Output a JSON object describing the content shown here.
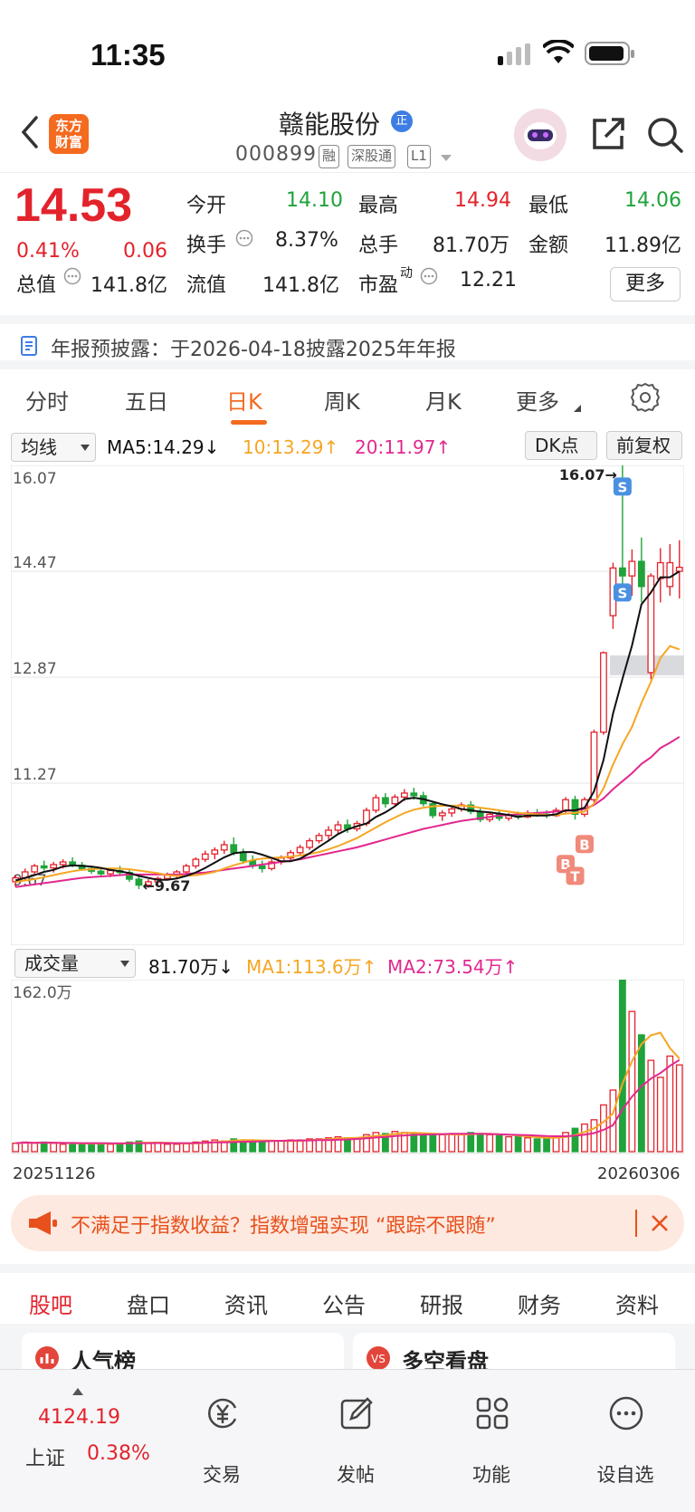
{
  "status_bar": {
    "time": "11:35"
  },
  "header": {
    "logo_line1": "东方",
    "logo_line2": "财富",
    "stock_name": "赣能股份",
    "verified_badge": "正",
    "stock_code": "000899",
    "tags": [
      "融",
      "深股通",
      "L1"
    ]
  },
  "quote": {
    "price": "14.53",
    "change_pct": "0.41%",
    "change": "0.06",
    "fields": [
      {
        "label": "今开",
        "value": "14.10",
        "color": "green"
      },
      {
        "label": "最高",
        "value": "14.94",
        "color": "red"
      },
      {
        "label": "最低",
        "value": "14.06",
        "color": "green"
      },
      {
        "label": "换手",
        "value": "8.37%",
        "color": "black"
      },
      {
        "label": "总手",
        "value": "81.70万",
        "color": "black"
      },
      {
        "label": "金额",
        "value": "11.89亿",
        "color": "black"
      },
      {
        "label": "总值",
        "value": "141.8亿",
        "color": "black"
      },
      {
        "label": "流值",
        "value": "141.8亿",
        "color": "black"
      },
      {
        "label": "市盈",
        "value": "12.21",
        "color": "black"
      }
    ],
    "pe_sup": "动",
    "more_label": "更多"
  },
  "notice": {
    "text": "年报预披露：于2026-04-18披露2025年年报"
  },
  "kline_tabs": {
    "items": [
      "分时",
      "五日",
      "日K",
      "周K",
      "月K",
      "更多"
    ],
    "active": 2
  },
  "ma_legend": {
    "indicator": "均线",
    "ma5": "MA5:14.29↓",
    "ma10": "10:13.29↑",
    "ma20": "20:11.97↑",
    "dk_label": "DK点",
    "adjust_label": "前复权"
  },
  "vol_legend": {
    "indicator": "成交量",
    "vol": "81.70万↓",
    "ma1": "MA1:113.6万↑",
    "ma2": "MA2:73.54万↑"
  },
  "colors": {
    "up": "#e3232c",
    "down": "#20a33b",
    "ma5": "#111111",
    "ma10": "#f5a623",
    "ma20": "#e2288f",
    "accent": "#f46a1f",
    "signal_b": "#f08a7a",
    "signal_s": "#4a90e2"
  },
  "chart_data": {
    "type": "candlestick",
    "y_ticks": [
      "16.07",
      "14.47",
      "12.87",
      "11.27",
      "9.67"
    ],
    "ylim": [
      9.67,
      16.07
    ],
    "max_label": "16.07→",
    "min_label": "←9.67",
    "signals": [
      "S",
      "S",
      "B",
      "B",
      "T"
    ],
    "volume": {
      "max_label": "162.0万",
      "ymax": 162.0,
      "start_date": "20251126",
      "end_date": "20260306"
    },
    "candles": [
      [
        9.78,
        9.88,
        9.7,
        9.84
      ],
      [
        9.84,
        9.98,
        9.8,
        9.93
      ],
      [
        9.93,
        10.05,
        9.88,
        10.02
      ],
      [
        10.02,
        10.1,
        9.95,
        9.99
      ],
      [
        9.99,
        10.08,
        9.92,
        10.04
      ],
      [
        10.04,
        10.12,
        9.98,
        10.08
      ],
      [
        10.08,
        10.15,
        10.0,
        10.03
      ],
      [
        10.03,
        10.08,
        9.95,
        9.98
      ],
      [
        9.98,
        10.02,
        9.9,
        9.94
      ],
      [
        9.94,
        10.0,
        9.86,
        9.9
      ],
      [
        9.9,
        9.98,
        9.85,
        9.95
      ],
      [
        9.95,
        10.02,
        9.88,
        9.92
      ],
      [
        9.92,
        9.96,
        9.78,
        9.82
      ],
      [
        9.82,
        9.86,
        9.67,
        9.73
      ],
      [
        9.73,
        9.82,
        9.69,
        9.78
      ],
      [
        9.78,
        9.86,
        9.74,
        9.83
      ],
      [
        9.83,
        9.92,
        9.8,
        9.88
      ],
      [
        9.88,
        9.96,
        9.84,
        9.93
      ],
      [
        9.93,
        10.05,
        9.9,
        10.02
      ],
      [
        10.02,
        10.15,
        9.98,
        10.12
      ],
      [
        10.12,
        10.25,
        10.08,
        10.2
      ],
      [
        10.2,
        10.3,
        10.12,
        10.26
      ],
      [
        10.26,
        10.4,
        10.2,
        10.34
      ],
      [
        10.34,
        10.45,
        10.18,
        10.22
      ],
      [
        10.22,
        10.28,
        10.05,
        10.1
      ],
      [
        10.1,
        10.18,
        9.98,
        10.02
      ],
      [
        10.02,
        10.1,
        9.92,
        9.98
      ],
      [
        9.98,
        10.12,
        9.95,
        10.08
      ],
      [
        10.08,
        10.18,
        10.04,
        10.14
      ],
      [
        10.14,
        10.26,
        10.1,
        10.22
      ],
      [
        10.22,
        10.34,
        10.18,
        10.3
      ],
      [
        10.3,
        10.44,
        10.26,
        10.4
      ],
      [
        10.4,
        10.52,
        10.36,
        10.48
      ],
      [
        10.48,
        10.62,
        10.42,
        10.56
      ],
      [
        10.56,
        10.7,
        10.5,
        10.64
      ],
      [
        10.64,
        10.72,
        10.52,
        10.58
      ],
      [
        10.58,
        10.7,
        10.54,
        10.66
      ],
      [
        10.66,
        10.9,
        10.62,
        10.86
      ],
      [
        10.86,
        11.1,
        10.82,
        11.05
      ],
      [
        11.05,
        11.12,
        10.9,
        10.96
      ],
      [
        10.96,
        11.1,
        10.92,
        11.06
      ],
      [
        11.06,
        11.18,
        11.0,
        11.12
      ],
      [
        11.12,
        11.2,
        11.02,
        11.08
      ],
      [
        11.08,
        11.14,
        10.92,
        10.96
      ],
      [
        10.96,
        11.0,
        10.74,
        10.78
      ],
      [
        10.78,
        10.86,
        10.7,
        10.82
      ],
      [
        10.82,
        10.92,
        10.76,
        10.88
      ],
      [
        10.88,
        10.98,
        10.84,
        10.94
      ],
      [
        10.94,
        11.0,
        10.8,
        10.84
      ],
      [
        10.84,
        10.9,
        10.68,
        10.72
      ],
      [
        10.72,
        10.84,
        10.68,
        10.8
      ],
      [
        10.8,
        10.86,
        10.7,
        10.74
      ],
      [
        10.74,
        10.82,
        10.7,
        10.78
      ],
      [
        10.78,
        10.84,
        10.72,
        10.76
      ],
      [
        10.76,
        10.86,
        10.74,
        10.82
      ],
      [
        10.82,
        10.88,
        10.76,
        10.8
      ],
      [
        10.8,
        10.86,
        10.74,
        10.78
      ],
      [
        10.78,
        10.9,
        10.76,
        10.86
      ],
      [
        10.86,
        11.06,
        10.82,
        11.02
      ],
      [
        11.02,
        11.08,
        10.72,
        10.8
      ],
      [
        10.8,
        11.06,
        10.76,
        11.02
      ],
      [
        11.02,
        12.08,
        10.98,
        12.04
      ],
      [
        12.04,
        13.26,
        12.0,
        13.24
      ],
      [
        13.8,
        14.6,
        13.6,
        14.52
      ],
      [
        14.52,
        16.07,
        14.2,
        14.4
      ],
      [
        14.4,
        14.8,
        14.1,
        14.62
      ],
      [
        14.62,
        14.98,
        14.0,
        14.24
      ],
      [
        12.94,
        14.44,
        12.84,
        14.4
      ],
      [
        14.36,
        14.82,
        14.0,
        14.6
      ],
      [
        14.24,
        14.88,
        14.1,
        14.6
      ],
      [
        14.47,
        14.94,
        14.06,
        14.53
      ]
    ],
    "ma5": [
      9.8,
      9.84,
      9.88,
      9.93,
      9.96,
      10.01,
      10.03,
      10.02,
      10.01,
      9.99,
      9.96,
      9.94,
      9.91,
      9.87,
      9.84,
      9.81,
      9.81,
      9.83,
      9.87,
      9.92,
      9.99,
      10.07,
      10.15,
      10.21,
      10.23,
      10.23,
      10.19,
      10.14,
      10.09,
      10.09,
      10.13,
      10.21,
      10.31,
      10.4,
      10.5,
      10.57,
      10.62,
      10.66,
      10.76,
      10.83,
      10.92,
      11.03,
      11.05,
      11.03,
      10.99,
      10.95,
      10.92,
      10.88,
      10.86,
      10.84,
      10.83,
      10.81,
      10.79,
      10.76,
      10.78,
      10.78,
      10.78,
      10.8,
      10.86,
      10.86,
      10.9,
      11.15,
      11.62,
      12.32,
      12.85,
      13.35,
      13.97,
      14.15,
      14.38,
      14.38,
      14.47
    ],
    "ma10": [
      9.78,
      9.8,
      9.82,
      9.85,
      9.88,
      9.91,
      9.94,
      9.96,
      9.97,
      9.98,
      9.98,
      9.98,
      9.97,
      9.95,
      9.93,
      9.91,
      9.88,
      9.87,
      9.87,
      9.88,
      9.9,
      9.93,
      9.98,
      10.03,
      10.07,
      10.11,
      10.13,
      10.14,
      10.15,
      10.16,
      10.18,
      10.2,
      10.23,
      10.27,
      10.32,
      10.38,
      10.44,
      10.52,
      10.6,
      10.68,
      10.75,
      10.82,
      10.87,
      10.9,
      10.92,
      10.93,
      10.93,
      10.93,
      10.92,
      10.9,
      10.88,
      10.86,
      10.84,
      10.82,
      10.81,
      10.8,
      10.79,
      10.79,
      10.81,
      10.82,
      10.84,
      10.96,
      11.19,
      11.55,
      11.86,
      12.12,
      12.48,
      12.8,
      13.16,
      13.34,
      13.29
    ],
    "ma20": [
      9.7,
      9.72,
      9.74,
      9.76,
      9.78,
      9.8,
      9.82,
      9.84,
      9.85,
      9.86,
      9.87,
      9.88,
      9.89,
      9.89,
      9.89,
      9.89,
      9.89,
      9.89,
      9.9,
      9.91,
      9.92,
      9.94,
      9.96,
      9.98,
      10.0,
      10.02,
      10.04,
      10.06,
      10.08,
      10.1,
      10.12,
      10.15,
      10.18,
      10.21,
      10.24,
      10.27,
      10.3,
      10.34,
      10.38,
      10.42,
      10.46,
      10.5,
      10.54,
      10.58,
      10.61,
      10.64,
      10.67,
      10.7,
      10.72,
      10.74,
      10.76,
      10.78,
      10.79,
      10.8,
      10.81,
      10.82,
      10.83,
      10.84,
      10.85,
      10.86,
      10.88,
      10.94,
      11.04,
      11.18,
      11.3,
      11.42,
      11.56,
      11.66,
      11.8,
      11.88,
      11.97
    ],
    "volumes": [
      8,
      9,
      8,
      9,
      8,
      7,
      8,
      7,
      8,
      8,
      7,
      8,
      9,
      10,
      8,
      8,
      7,
      7,
      8,
      9,
      10,
      11,
      10,
      12,
      11,
      10,
      9,
      10,
      10,
      11,
      11,
      12,
      12,
      13,
      14,
      13,
      13,
      16,
      18,
      17,
      19,
      18,
      17,
      16,
      15,
      16,
      17,
      16,
      18,
      17,
      16,
      15,
      14,
      14,
      13,
      12,
      12,
      14,
      18,
      22,
      26,
      30,
      44,
      58,
      162,
      132,
      110,
      86,
      70,
      90,
      81.7
    ]
  },
  "ad": {
    "text": "不满足于指数收益？指数增强实现 “跟踪不跟随”"
  },
  "bottom_tabs": {
    "items": [
      "股吧",
      "盘口",
      "资讯",
      "公告",
      "研报",
      "财务",
      "资料"
    ],
    "active": 0
  },
  "cards": {
    "left": "人气榜",
    "right": "多空看盘"
  },
  "bottom_bar": {
    "index_value": "4124.19",
    "index_name": "上证",
    "index_change": "0.38%",
    "items": [
      "交易",
      "发帖",
      "功能",
      "设自选"
    ]
  }
}
